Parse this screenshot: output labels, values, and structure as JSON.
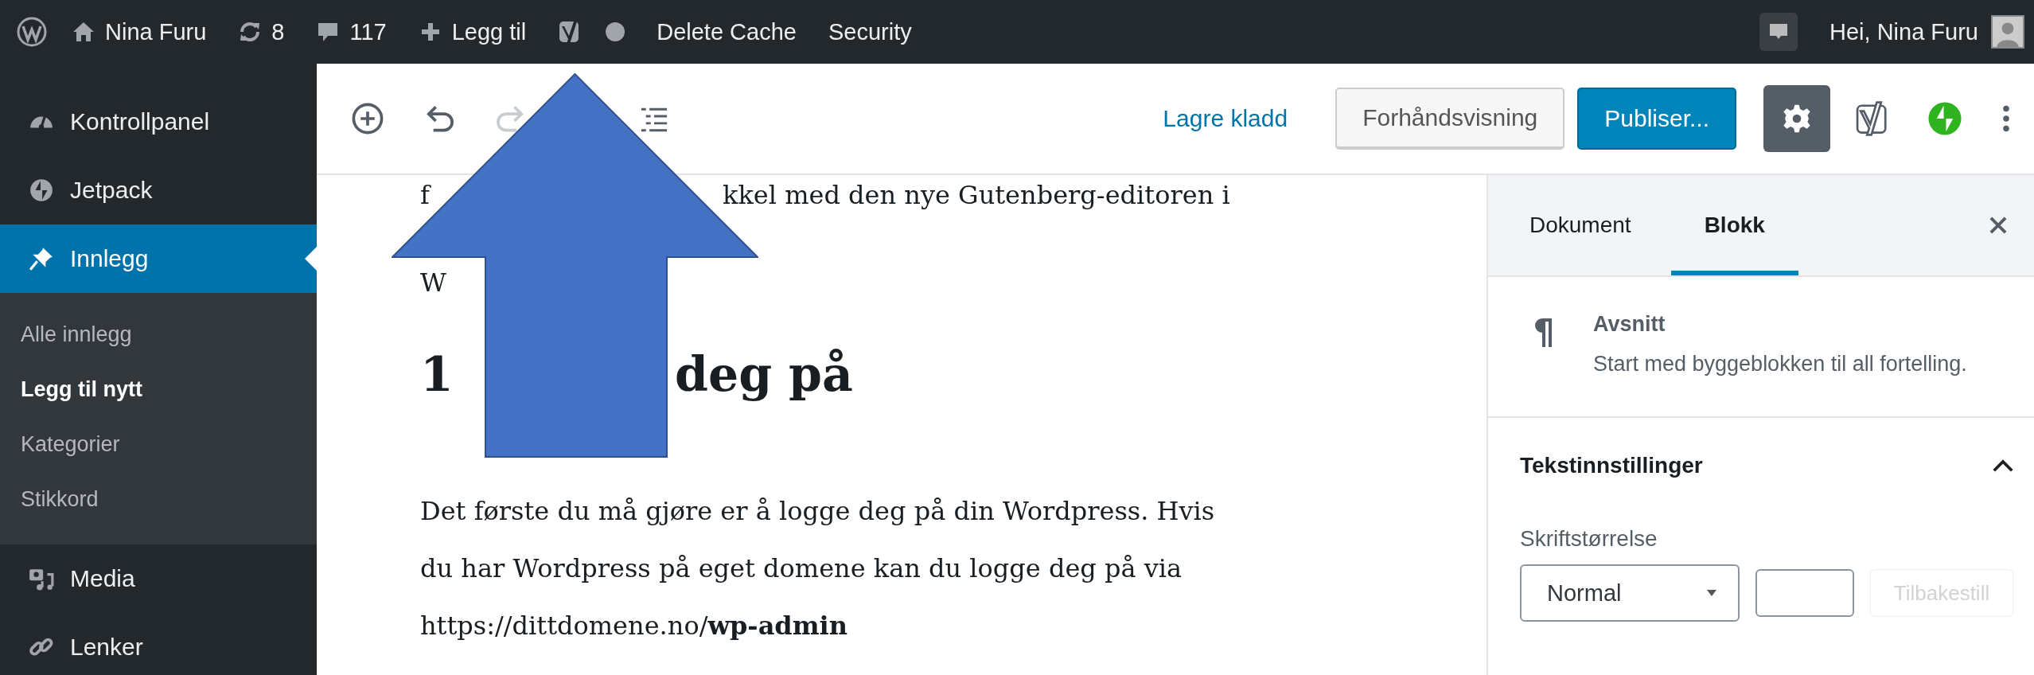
{
  "admin_bar": {
    "site_name": "Nina Furu",
    "updates": "8",
    "comments": "117",
    "new_label": "Legg til",
    "links": [
      "Delete Cache",
      "Security"
    ],
    "greeting": "Hei, Nina Furu"
  },
  "sidebar": {
    "items": [
      {
        "label": "Kontrollpanel",
        "selected": false
      },
      {
        "label": "Jetpack",
        "selected": false
      },
      {
        "label": "Innlegg",
        "selected": true,
        "children": [
          {
            "label": "Alle innlegg",
            "selected": false
          },
          {
            "label": "Legg til nytt",
            "selected": true
          },
          {
            "label": "Kategorier",
            "selected": false
          },
          {
            "label": "Stikkord",
            "selected": false
          }
        ]
      },
      {
        "label": "Media",
        "selected": false
      },
      {
        "label": "Lenker",
        "selected": false
      }
    ]
  },
  "toolbar": {
    "redo_disabled": true,
    "save_draft": "Lagre kladd",
    "preview": "Forhåndsvisning",
    "publish": "Publiser...",
    "settings_active": true
  },
  "editor": {
    "lines": [
      {
        "kind": "text",
        "parts": [
          "f",
          "kkel med den nye Gutenberg-editoren i"
        ]
      },
      {
        "kind": "text",
        "parts": [
          "W"
        ]
      },
      {
        "kind": "heading",
        "parts": [
          "1",
          "deg på"
        ]
      },
      {
        "kind": "paragraph",
        "parts": [
          "Det første du må gjøre er å logge deg på din Wordpress. Hvis",
          "du har Wordpress på eget domene kan du logge deg på via",
          "https://dittdomene.no/**wp-admin**"
        ]
      }
    ]
  },
  "panel": {
    "tabs": [
      {
        "label": "Dokument",
        "selected": false
      },
      {
        "label": "Blokk",
        "selected": true
      }
    ],
    "block_name": "Avsnitt",
    "block_description": "Start med byggeblokken til all fortelling.",
    "section": {
      "title": "Tekstinnstillinger",
      "expanded": true,
      "font_size_label": "Skriftstørrelse",
      "font_size_value": "Normal",
      "reset_label": "Tilbakestill",
      "reset_disabled": true
    }
  }
}
